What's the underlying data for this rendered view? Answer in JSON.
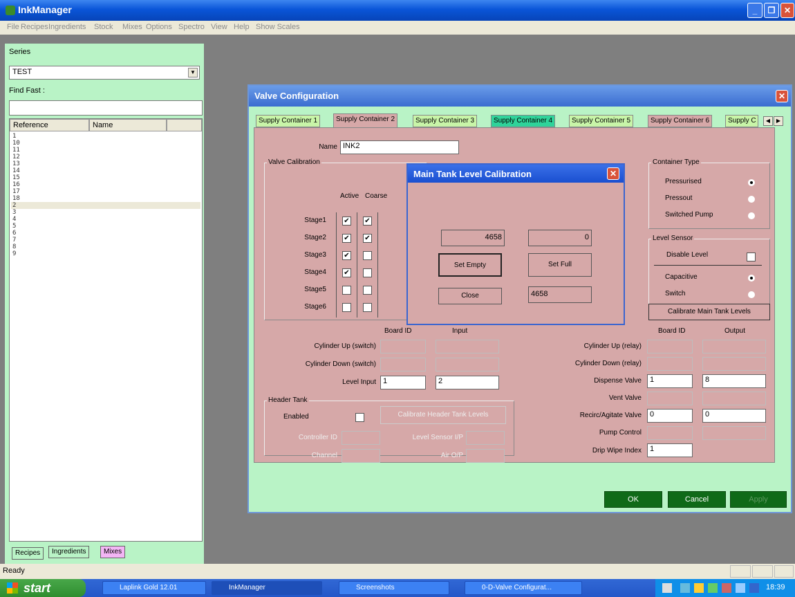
{
  "app": {
    "title": "InkManager"
  },
  "menu": [
    "File",
    "Recipes",
    "Ingredients",
    "Stock",
    "Mixes",
    "Options",
    "Spectro",
    "View",
    "Help",
    "Show Scales"
  ],
  "left_panel": {
    "series_label": "Series",
    "series_value": "TEST",
    "find_fast_label": "Find Fast :",
    "find_fast_value": "",
    "columns": [
      "Reference",
      "Name"
    ],
    "rows": [
      "1",
      "10",
      "11",
      "12",
      "13",
      "14",
      "15",
      "16",
      "17",
      "18",
      "2",
      "3",
      "4",
      "5",
      "6",
      "7",
      "8",
      "9"
    ],
    "selected_row": "2",
    "tabs": [
      "Recipes",
      "Ingredients",
      "Mixes"
    ]
  },
  "status": {
    "text": "Ready"
  },
  "taskbar": {
    "start": "start",
    "items": [
      "Laplink Gold 12.01",
      "InkManager",
      "Screenshots",
      "0-D-Valve Configurat..."
    ],
    "clock": "18:39"
  },
  "dialog": {
    "title": "Valve Configuration",
    "tabs": [
      "Supply Container 1",
      "Supply Container 2",
      "Supply Container 3",
      "Supply Container 4",
      "Supply Container 5",
      "Supply Container 6",
      "Supply C"
    ],
    "name_label": "Name",
    "name_value": "INK2",
    "valve_calibration": {
      "title": "Valve Calibration",
      "active_label": "Active",
      "coarse_label": "Coarse",
      "stages": [
        {
          "label": "Stage1",
          "active": true,
          "coarse": true
        },
        {
          "label": "Stage2",
          "active": true,
          "coarse": true
        },
        {
          "label": "Stage3",
          "active": true,
          "coarse": false
        },
        {
          "label": "Stage4",
          "active": true,
          "coarse": false
        },
        {
          "label": "Stage5",
          "active": false,
          "coarse": false
        },
        {
          "label": "Stage6",
          "active": false,
          "coarse": false
        }
      ]
    },
    "container_type": {
      "title": "Container Type",
      "options": [
        "Pressurised",
        "Pressout",
        "Switched Pump"
      ],
      "selected": "Pressurised"
    },
    "level_sensor": {
      "title": "Level Sensor",
      "disable_label": "Disable Level",
      "options": [
        "Capacitive",
        "Switch"
      ],
      "selected": "Capacitive",
      "calibrate_button": "Calibrate Main Tank Levels"
    },
    "inputs": {
      "board_id_label": "Board ID",
      "input_label": "Input",
      "rows": [
        {
          "label": "Cylinder Up (switch)",
          "board": "",
          "value": "",
          "enabled": false
        },
        {
          "label": "Cylinder Down (switch)",
          "board": "",
          "value": "",
          "enabled": false
        },
        {
          "label": "Level Input",
          "board": "1",
          "value": "2",
          "enabled": true
        }
      ]
    },
    "outputs": {
      "board_id_label": "Board ID",
      "output_label": "Output",
      "rows": [
        {
          "label": "Cylinder Up (relay)",
          "board": "",
          "value": "",
          "enabled": false
        },
        {
          "label": "Cylinder Down (relay)",
          "board": "",
          "value": "",
          "enabled": false
        },
        {
          "label": "Dispense Valve",
          "board": "1",
          "value": "8",
          "enabled": true
        },
        {
          "label": "Vent Valve",
          "board": "",
          "value": "",
          "enabled": false
        },
        {
          "label": "Recirc/Agitate Valve",
          "board": "0",
          "value": "0",
          "enabled": true
        },
        {
          "label": "Pump Control",
          "board": "",
          "value": "",
          "enabled": false
        }
      ],
      "drip_label": "Drip Wipe Index",
      "drip_value": "1"
    },
    "header_tank": {
      "title": "Header Tank",
      "enabled_label": "Enabled",
      "calibrate_button": "Calibrate Header Tank Levels",
      "controller_label": "Controller ID",
      "channel_label": "Channel",
      "level_sensor_label": "Level Sensor I/P",
      "air_label": "Air O/P"
    },
    "buttons": {
      "ok": "OK",
      "cancel": "Cancel",
      "apply": "Apply"
    }
  },
  "calib_dialog": {
    "title": "Main Tank Level Calibration",
    "empty_value": "4658",
    "full_value": "0",
    "set_empty": "Set Empty",
    "set_full": "Set Full",
    "close": "Close",
    "current_value": "4658"
  }
}
